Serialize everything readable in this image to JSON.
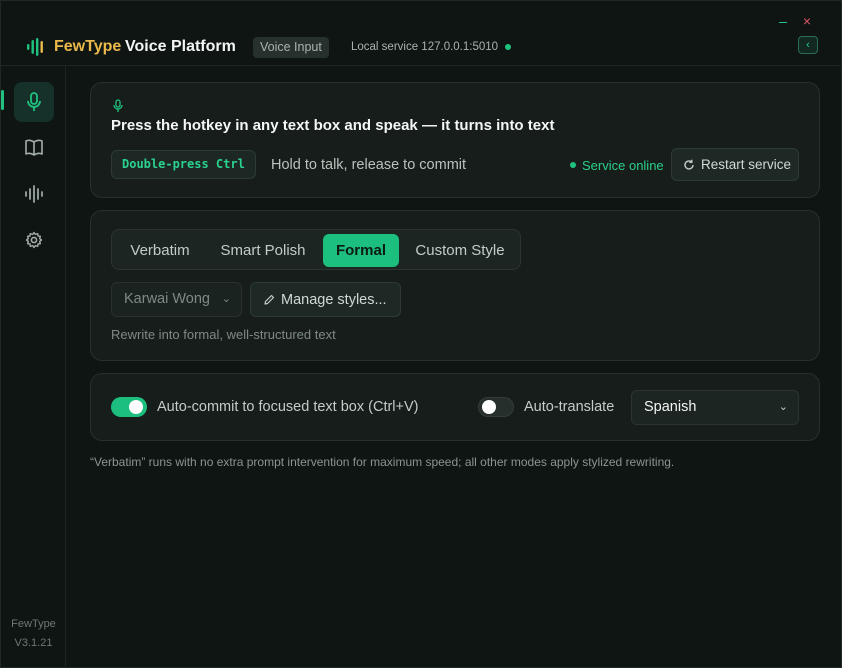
{
  "header": {
    "brand": "FewType",
    "title": "Voice Platform",
    "mode_badge": "Voice Input",
    "service_info": "Local service 127.0.0.1:5010",
    "collapse_glyph": "‹",
    "minimize_glyph": "–",
    "close_glyph": "×"
  },
  "sidebar": {
    "items": [
      {
        "name": "mic-icon",
        "active": true
      },
      {
        "name": "book-icon",
        "active": false
      },
      {
        "name": "waveform-icon",
        "active": false
      },
      {
        "name": "gear-icon",
        "active": false
      }
    ],
    "version_name": "FewType",
    "version": "V3.1.21"
  },
  "hotkey_card": {
    "headline": "Press the hotkey in any text box and speak — it turns into text",
    "hotkey": "Double-press Ctrl",
    "hint": "Hold to talk, release to commit",
    "status": "Service online",
    "restart_label": "Restart service"
  },
  "style_card": {
    "tabs": [
      "Verbatim",
      "Smart Polish",
      "Formal",
      "Custom Style"
    ],
    "active_tab": "Formal",
    "profile": "Karwai Wong",
    "manage_label": "Manage styles...",
    "description": "Rewrite into formal, well-structured text"
  },
  "options_card": {
    "auto_commit_label": "Auto-commit to focused text box (Ctrl+V)",
    "auto_commit_on": true,
    "auto_translate_label": "Auto-translate",
    "auto_translate_on": false,
    "language": "Spanish"
  },
  "footnote": "“Verbatim” runs with no extra prompt intervention for maximum speed; all other modes apply stylized rewriting.",
  "colors": {
    "accent": "#1dbf7e",
    "brand": "#e9b949",
    "background": "#0f1513",
    "card": "#161d1a"
  }
}
